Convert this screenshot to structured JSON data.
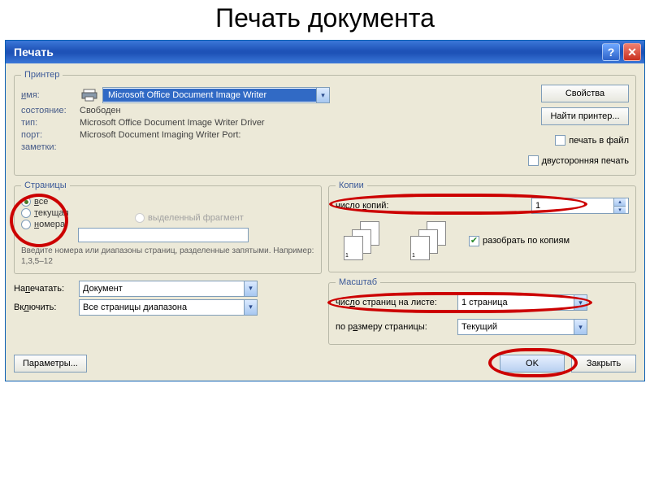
{
  "page_heading": "Печать документа",
  "titlebar": {
    "title": "Печать"
  },
  "printer": {
    "legend": "Принтер",
    "name_label": "имя:",
    "selected": "Microsoft Office Document Image Writer",
    "state_label": "состояние:",
    "state_val": "Свободен",
    "type_label": "тип:",
    "type_val": "Microsoft Office Document Image Writer Driver",
    "port_label": "порт:",
    "port_val": "Microsoft Document Imaging Writer Port:",
    "notes_label": "заметки:",
    "btn_properties": "Свойства",
    "btn_find": "Найти принтер...",
    "chk_tofile": "печать в файл",
    "chk_duplex": "двусторонняя печать"
  },
  "pages": {
    "legend": "Страницы",
    "r_all": "все",
    "r_current": "текущая",
    "r_selection": "выделенный фрагмент",
    "r_numbers": "номера:",
    "help": "Введите номера или диапазоны страниц, разделенные запятыми. Например: 1,3,5–12"
  },
  "copies": {
    "legend": "Копии",
    "count_label": "число копий:",
    "count_value": "1",
    "collate": "разобрать по копиям"
  },
  "scale": {
    "legend": "Масштаб",
    "pps_label": "число страниц на листе:",
    "pps_value": "1 страница",
    "fit_label": "по размеру страницы:",
    "fit_value": "Текущий"
  },
  "print_what": {
    "label": "Напечатать:",
    "value": "Документ"
  },
  "include": {
    "label": "Включить:",
    "value": "Все страницы диапазона"
  },
  "buttons": {
    "params": "Параметры...",
    "ok": "OK",
    "close": "Закрыть"
  }
}
